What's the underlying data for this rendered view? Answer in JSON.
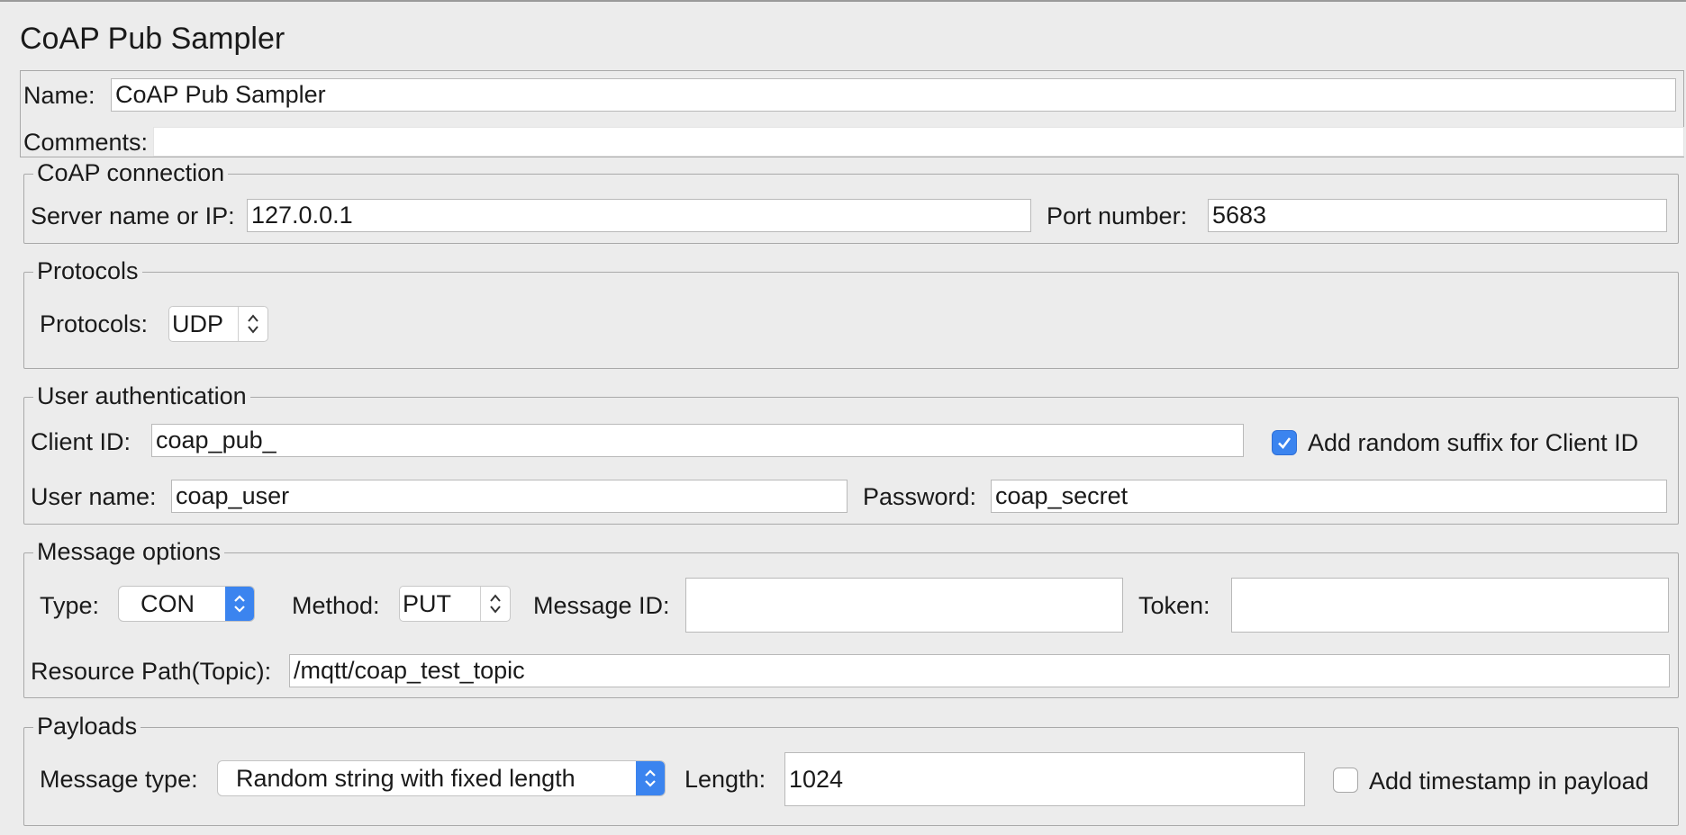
{
  "title": "CoAP Pub Sampler",
  "name": {
    "label": "Name:",
    "value": "CoAP Pub Sampler"
  },
  "comments": {
    "label": "Comments:",
    "value": ""
  },
  "connection": {
    "legend": "CoAP connection",
    "server_label": "Server name or IP:",
    "server_value": "127.0.0.1",
    "port_label": "Port number:",
    "port_value": "5683"
  },
  "protocols": {
    "legend": "Protocols",
    "label": "Protocols:",
    "value": "UDP"
  },
  "auth": {
    "legend": "User authentication",
    "client_id_label": "Client ID:",
    "client_id_value": "coap_pub_",
    "random_suffix_label": "Add random suffix for Client ID",
    "random_suffix_checked": true,
    "username_label": "User name:",
    "username_value": "coap_user",
    "password_label": "Password:",
    "password_value": "coap_secret"
  },
  "message": {
    "legend": "Message options",
    "type_label": "Type:",
    "type_value": "CON",
    "method_label": "Method:",
    "method_value": "PUT",
    "message_id_label": "Message ID:",
    "message_id_value": "",
    "token_label": "Token:",
    "token_value": "",
    "resource_label": "Resource Path(Topic):",
    "resource_value": "/mqtt/coap_test_topic"
  },
  "payloads": {
    "legend": "Payloads",
    "type_label": "Message type:",
    "type_value": "Random string with fixed length",
    "length_label": "Length:",
    "length_value": "1024",
    "timestamp_label": "Add timestamp in payload",
    "timestamp_checked": false
  },
  "icons": {
    "spinner": "up-down-arrows-icon",
    "combo": "chevron-up-down-icon",
    "check": "checkmark-icon"
  },
  "colors": {
    "accent": "#3b84ef",
    "background": "#ececec"
  }
}
